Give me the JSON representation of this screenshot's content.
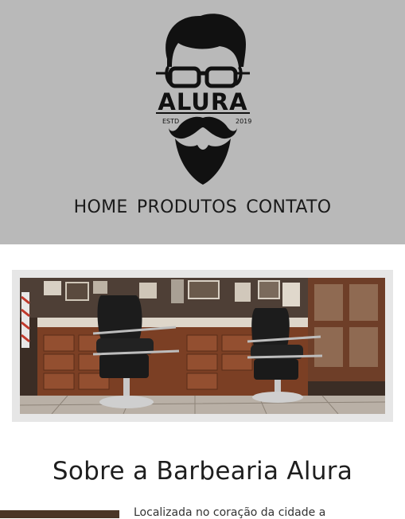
{
  "brand": {
    "name": "ALURA",
    "estd_label": "ESTD",
    "estd_year": "2019"
  },
  "nav": {
    "items": [
      "HOME",
      "PRODUTOS",
      "CONTATO"
    ]
  },
  "banner": {
    "alt": "Interior da barbearia com cadeiras de barbeiro"
  },
  "about": {
    "title": "Sobre a Barbearia Alura",
    "text_preview": "Localizada no coração da cidade a"
  },
  "colors": {
    "header_bg": "#b9b9b9",
    "frame_bg": "#e6e6e6",
    "text": "#1e1e1e"
  }
}
